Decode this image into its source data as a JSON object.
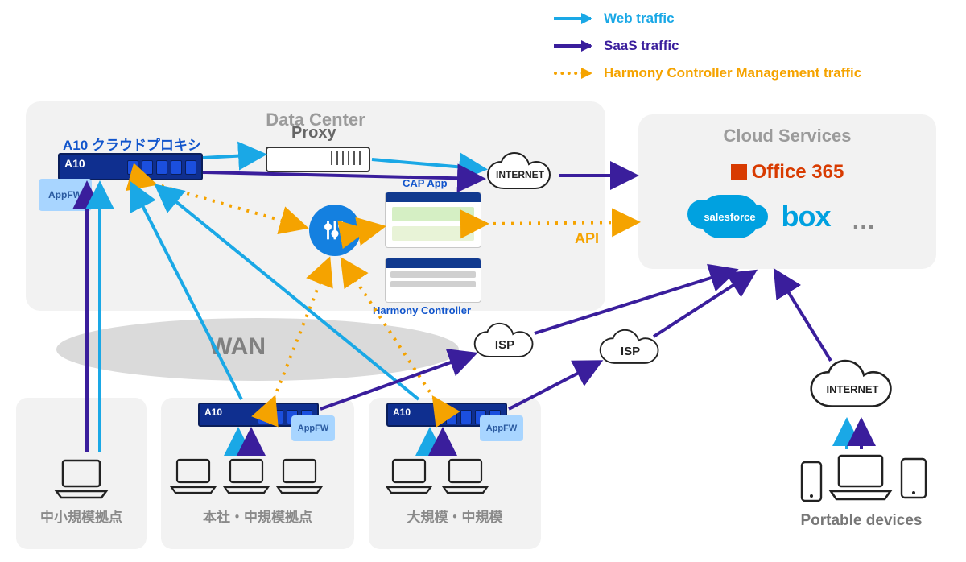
{
  "legend": {
    "web": "Web traffic",
    "saas": "SaaS traffic",
    "mgmt": "Harmony Controller Management traffic"
  },
  "colors": {
    "web": "#1aa8e6",
    "saas": "#3a1e9c",
    "mgmt": "#f5a300",
    "panel_title": "#9b9b9b",
    "link_blue": "#1155cc"
  },
  "datacenter": {
    "title": "Data Center",
    "a10_title": "A10 クラウドプロキシ",
    "a10_brand": "A10",
    "proxy_label": "Proxy",
    "appfw": "AppFW",
    "cap_app": "CAP App",
    "harmony": "Harmony Controller"
  },
  "wan_label": "WAN",
  "clouds": {
    "internet": "INTERNET",
    "isp": "ISP"
  },
  "api_label": "API",
  "cloud_services": {
    "title": "Cloud Services",
    "office": "Office 365",
    "salesforce": "salesforce",
    "box": "box",
    "more": "…"
  },
  "sites": {
    "small": "中小規模拠点",
    "hq": "本社・中規模拠点",
    "large": "大規模・中規模"
  },
  "portable": {
    "label": "Portable devices"
  }
}
